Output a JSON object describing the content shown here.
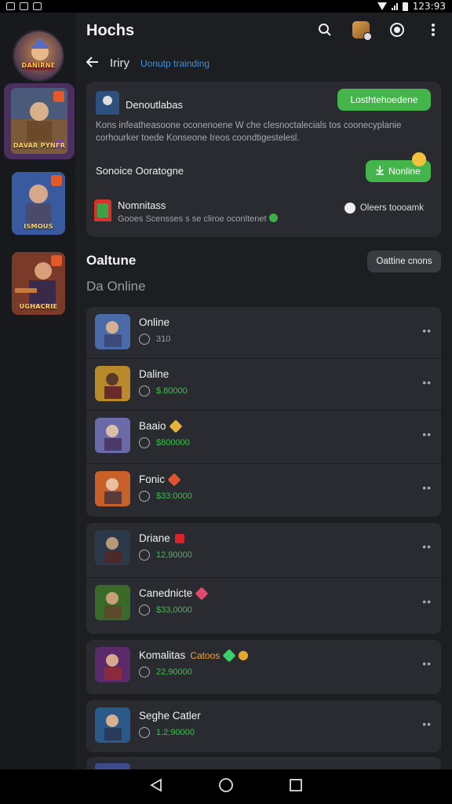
{
  "status_bar": {
    "time": "123:93"
  },
  "header": {
    "title": "Hochs",
    "back_label": "Iriry",
    "link_text": "Uonutp trainding"
  },
  "sidebar": {
    "avatar_label": "DANIRNE",
    "games": [
      {
        "label": "DAVAR PYNFR"
      },
      {
        "label": "ISMOUS"
      },
      {
        "label": "UGHACRIE"
      }
    ]
  },
  "notification": {
    "title": "Denoutlabas",
    "action_label": "Losthtehoedene",
    "description": "Kons infeatheasoone oconenoene W che clesnoctalecials tos coonecyplanie corhourker toede Konseone Ireos coondtigestelesl.",
    "subtitle": "Sonoice Ooratogne",
    "online_label": "Nonline",
    "row_name": "Nomnitass",
    "row_detail": "Gooes Scensses s se cliroe oconltenet",
    "row_status": "Oleers toooamk"
  },
  "section": {
    "title": "Oaltune",
    "subtitle": "Da Online",
    "button_label": "Oattine cnons"
  },
  "groups": [
    {
      "items": [
        {
          "name": "Online",
          "value": "310",
          "value_color": "#9c9da3",
          "icon_color": ""
        },
        {
          "name": "Daline",
          "value": "$.80000",
          "value_color": "#3cbf4d",
          "icon_color": ""
        },
        {
          "name": "Baaio",
          "value": "$800000",
          "value_color": "#3cbf4d",
          "icon_color": "#e8b33a"
        },
        {
          "name": "Fonic",
          "value": "$33:0000",
          "value_color": "#3cbf4d",
          "icon_color": "#e0552f"
        }
      ]
    },
    {
      "items": [
        {
          "name": "Driane",
          "value": "12,90000",
          "value_color": "#3cbf4d",
          "icon_color": "#d8242b"
        },
        {
          "name": "Canednicte",
          "value": "$33,0000",
          "value_color": "#3cbf4d",
          "icon_color": "#e2496a"
        }
      ]
    },
    {
      "items": [
        {
          "name": "Komalitas",
          "extra": "Catoos",
          "value": "22,90000",
          "value_color": "#3cbf4d",
          "icon_color": "#3cd068"
        }
      ]
    },
    {
      "items": [
        {
          "name": "Seghe Catler",
          "value": "1.2;90000",
          "value_color": "#3cbf4d",
          "icon_color": ""
        }
      ]
    }
  ]
}
